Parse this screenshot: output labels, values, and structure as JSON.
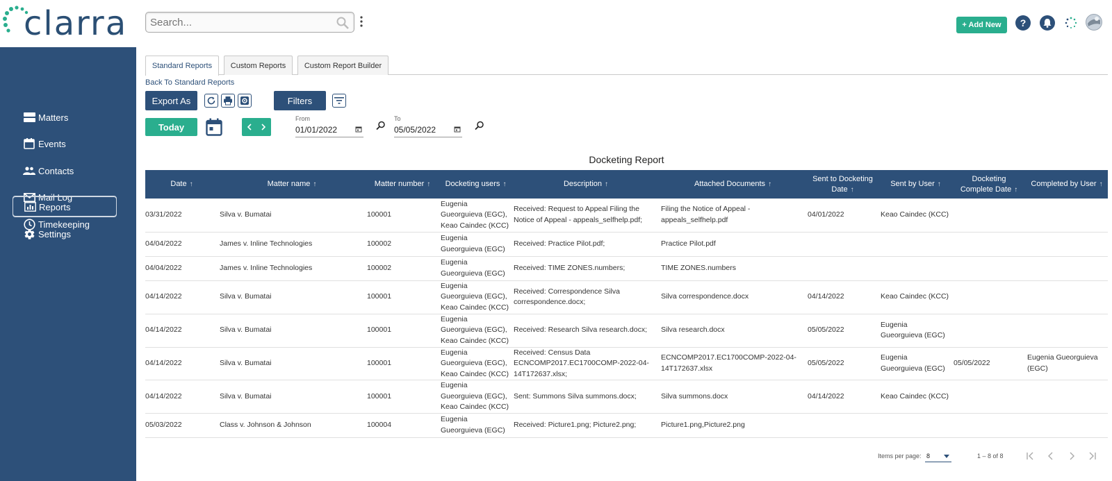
{
  "app": {
    "logo_text": "clarra"
  },
  "search": {
    "placeholder": "Search..."
  },
  "header": {
    "add_new_label": "+ Add New"
  },
  "sidebar": {
    "items": [
      {
        "label": "Matters",
        "icon": "matters-icon"
      },
      {
        "label": "Events",
        "icon": "calendar-icon"
      },
      {
        "label": "Contacts",
        "icon": "people-icon"
      },
      {
        "label": "Mail Log",
        "icon": "mail-icon"
      },
      {
        "label": "Timekeeping",
        "icon": "clock-icon"
      },
      {
        "label": "Reports",
        "icon": "reports-icon",
        "active": true
      },
      {
        "label": "Settings",
        "icon": "gear-icon"
      }
    ]
  },
  "tabs": [
    {
      "label": "Standard Reports",
      "active": true
    },
    {
      "label": "Custom Reports"
    },
    {
      "label": "Custom Report Builder"
    }
  ],
  "toolbar": {
    "back_link": "Back To Standard Reports",
    "export_label": "Export As",
    "filters_label": "Filters",
    "today_label": "Today",
    "from_label": "From",
    "from_value": "01/01/2022",
    "to_label": "To",
    "to_value": "05/05/2022"
  },
  "report": {
    "title": "Docketing Report",
    "columns": [
      "Date",
      "Matter name",
      "Matter number",
      "Docketing users",
      "Description",
      "Attached Documents",
      "Sent to Docketing Date",
      "Sent by User",
      "Docketing Complete Date",
      "Completed by User"
    ],
    "rows": [
      [
        "03/31/2022",
        "Silva v. Bumatai",
        "100001",
        "Eugenia Gueorguieva (EGC), Keao Caindec (KCC)",
        "Received: Request to Appeal Filing the Notice of Appeal - appeals_selfhelp.pdf;",
        "Filing the Notice of Appeal - appeals_selfhelp.pdf",
        "04/01/2022",
        "Keao Caindec (KCC)",
        "",
        ""
      ],
      [
        "04/04/2022",
        "James v. Inline Technologies",
        "100002",
        "Eugenia Gueorguieva (EGC)",
        "Received: Practice Pilot.pdf;",
        "Practice Pilot.pdf",
        "",
        "",
        "",
        ""
      ],
      [
        "04/04/2022",
        "James v. Inline Technologies",
        "100002",
        "Eugenia Gueorguieva (EGC)",
        "Received: TIME ZONES.numbers;",
        "TIME ZONES.numbers",
        "",
        "",
        "",
        ""
      ],
      [
        "04/14/2022",
        "Silva v. Bumatai",
        "100001",
        "Eugenia Gueorguieva (EGC), Keao Caindec (KCC)",
        "Received: Correspondence Silva correspondence.docx;",
        "Silva correspondence.docx",
        "04/14/2022",
        "Keao Caindec (KCC)",
        "",
        ""
      ],
      [
        "04/14/2022",
        "Silva v. Bumatai",
        "100001",
        "Eugenia Gueorguieva (EGC), Keao Caindec (KCC)",
        "Received: Research Silva research.docx;",
        "Silva research.docx",
        "05/05/2022",
        "Eugenia Gueorguieva (EGC)",
        "",
        ""
      ],
      [
        "04/14/2022",
        "Silva v. Bumatai",
        "100001",
        "Eugenia Gueorguieva (EGC), Keao Caindec (KCC)",
        "Received: Census Data ECNCOMP2017.EC1700COMP-2022-04-14T172637.xlsx;",
        "ECNCOMP2017.EC1700COMP-2022-04-14T172637.xlsx",
        "05/05/2022",
        "Eugenia Gueorguieva (EGC)",
        "05/05/2022",
        "Eugenia Gueorguieva (EGC)"
      ],
      [
        "04/14/2022",
        "Silva v. Bumatai",
        "100001",
        "Eugenia Gueorguieva (EGC), Keao Caindec (KCC)",
        "Sent: Summons Silva summons.docx;",
        "Silva summons.docx",
        "04/14/2022",
        "Keao Caindec (KCC)",
        "",
        ""
      ],
      [
        "05/03/2022",
        "Class v. Johnson & Johnson",
        "100004",
        "Eugenia Gueorguieva (EGC)",
        "Received: Picture1.png; Picture2.png;",
        "Picture1.png,Picture2.png",
        "",
        "",
        "",
        ""
      ]
    ]
  },
  "paginator": {
    "items_per_page_label": "Items per page:",
    "items_per_page_value": "8",
    "range_label": "1 – 8 of 8"
  },
  "colors": {
    "primary": "#2d5079",
    "accent": "#2aae8e"
  }
}
